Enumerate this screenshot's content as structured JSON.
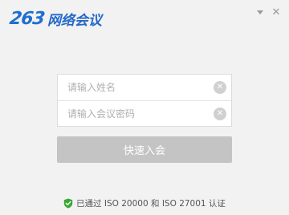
{
  "logo": {
    "number": "263",
    "text": "网络会议"
  },
  "window_controls": {
    "menu_icon": "dropdown-triangle-icon",
    "close_icon": "close-icon"
  },
  "form": {
    "name_placeholder": "请输入姓名",
    "password_placeholder": "请输入会议密码",
    "clear_icon": "clear-circle-icon"
  },
  "join_button": {
    "label": "快速入会"
  },
  "certification": {
    "icon": "shield-check-icon",
    "text": "已通过 ISO 20000 和 ISO 27001 认证"
  },
  "colors": {
    "brand_blue": "#1f6fcf",
    "shield_green": "#3aa832",
    "button_disabled": "#c4c4c4"
  }
}
